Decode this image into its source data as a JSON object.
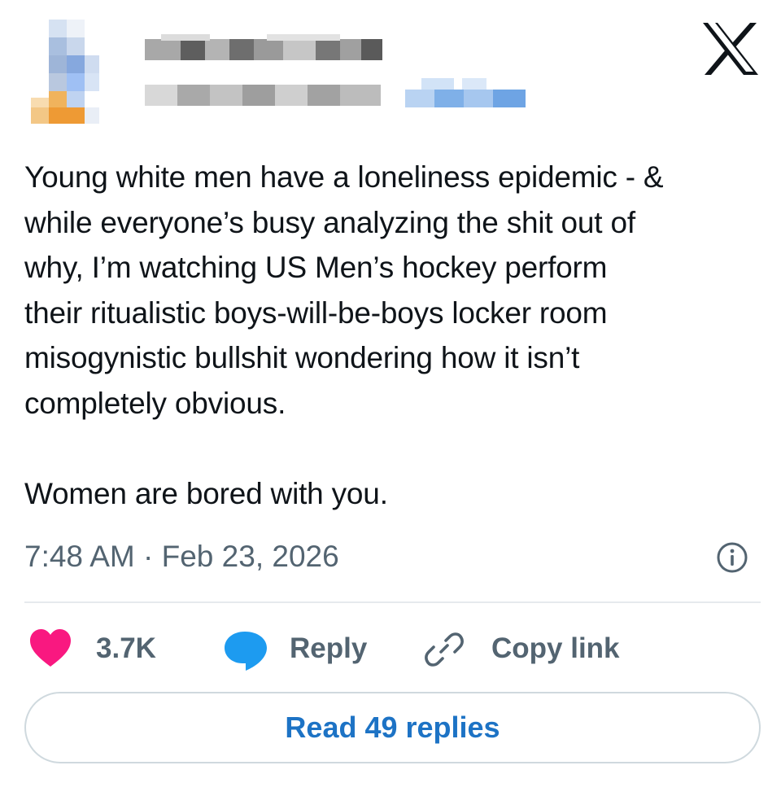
{
  "tweet": {
    "text_lines": [
      "Young white men have a loneliness epidemic - &",
      "while everyone’s busy analyzing the shit out of",
      "why, I’m watching US Men’s hockey perform",
      "their ritualistic boys-will-be-boys locker room",
      "misogynistic bullshit wondering how it isn’t",
      "completely obvious."
    ],
    "closing_line": "Women are bored with you.",
    "timestamp": "7:48 AM · Feb 23, 2026"
  },
  "actions": {
    "likes_count": "3.7K",
    "reply_label": "Reply",
    "copy_link_label": "Copy link"
  },
  "read_replies_label": "Read 49 replies",
  "icons": {
    "brand": "x-logo-icon",
    "info": "info-icon",
    "like": "heart-icon",
    "reply": "speech-bubble-icon",
    "copy_link": "link-icon"
  },
  "colors": {
    "text": "#0f1419",
    "secondary_text": "#536471",
    "like": "#f91880",
    "reply": "#1d9bf0",
    "link": "#1d73c5",
    "border": "#cfd9de"
  }
}
